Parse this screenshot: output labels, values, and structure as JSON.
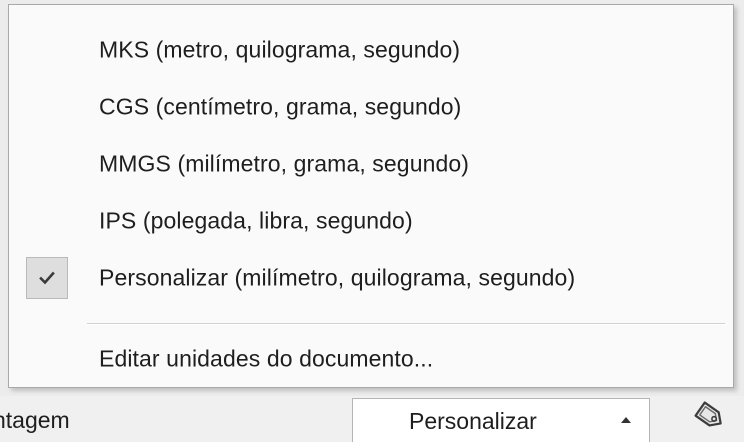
{
  "menu": {
    "items": [
      {
        "label": "MKS (metro, quilograma, segundo)",
        "checked": false
      },
      {
        "label": "CGS (centímetro, grama, segundo)",
        "checked": false
      },
      {
        "label": "MMGS (milímetro, grama, segundo)",
        "checked": false
      },
      {
        "label": "IPS (polegada, libra, segundo)",
        "checked": false
      },
      {
        "label": "Personalizar (milímetro, quilograma, segundo)",
        "checked": true
      }
    ],
    "edit_units_label": "Editar unidades do documento..."
  },
  "statusbar": {
    "left_text": "ntagem",
    "unit_system_value": "Personalizar",
    "icons": {
      "checkmark": "checkmark-icon",
      "dropdown_arrow": "up-arrow-icon",
      "tag": "tag-icon"
    }
  }
}
